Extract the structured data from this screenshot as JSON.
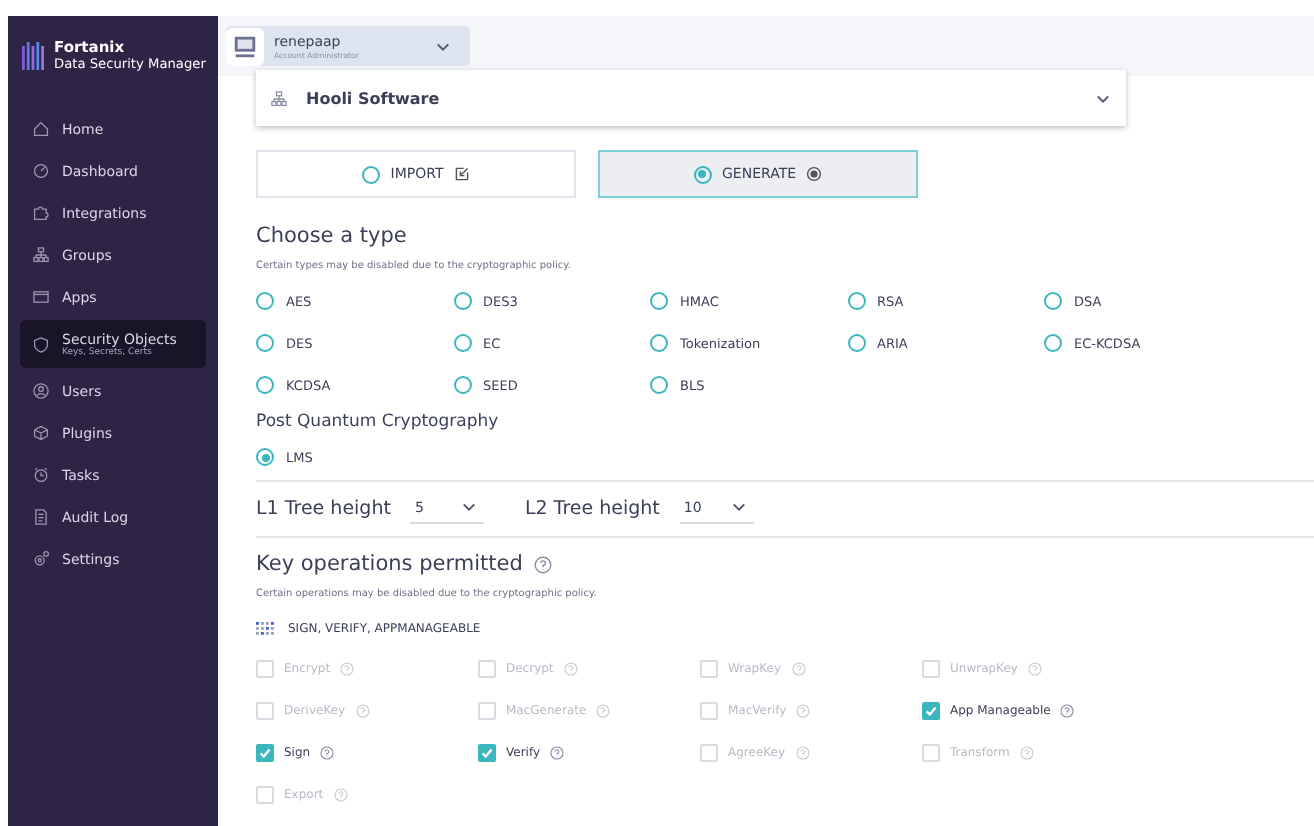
{
  "sidebar": {
    "logo": {
      "brand": "Fortanix",
      "product": "Data Security Manager"
    },
    "items": [
      {
        "label": "Home",
        "kind": "home",
        "selected": false
      },
      {
        "label": "Dashboard",
        "kind": "gauge",
        "selected": false
      },
      {
        "label": "Integrations",
        "kind": "puzzle",
        "selected": false
      },
      {
        "label": "Groups",
        "kind": "tree",
        "selected": false
      },
      {
        "label": "Apps",
        "kind": "window",
        "selected": false
      },
      {
        "label": "Security Objects",
        "sublabel": "Keys, Secrets, Certs",
        "kind": "shield",
        "selected": true
      },
      {
        "label": "Users",
        "kind": "user",
        "selected": false
      },
      {
        "label": "Plugins",
        "kind": "box",
        "selected": false
      },
      {
        "label": "Tasks",
        "kind": "clock",
        "selected": false
      },
      {
        "label": "Audit Log",
        "kind": "log",
        "selected": false
      },
      {
        "label": "Settings",
        "kind": "gear",
        "selected": false
      }
    ]
  },
  "account": {
    "name": "renepaap",
    "role": "Account Administrator"
  },
  "group_select": {
    "value": "Hooli Software"
  },
  "mode_buttons": [
    {
      "label": "IMPORT",
      "selected": false
    },
    {
      "label": "GENERATE",
      "selected": true
    }
  ],
  "type_section": {
    "title": "Choose a type",
    "note": "Certain types may be disabled due to the cryptographic policy.",
    "types": [
      {
        "label": "AES",
        "selected": false
      },
      {
        "label": "DES3",
        "selected": false
      },
      {
        "label": "HMAC",
        "selected": false
      },
      {
        "label": "RSA",
        "selected": false
      },
      {
        "label": "DSA",
        "selected": false
      },
      {
        "label": "DES",
        "selected": false
      },
      {
        "label": "EC",
        "selected": false
      },
      {
        "label": "Tokenization",
        "selected": false
      },
      {
        "label": "ARIA",
        "selected": false
      },
      {
        "label": "EC-KCDSA",
        "selected": false
      },
      {
        "label": "KCDSA",
        "selected": false
      },
      {
        "label": "SEED",
        "selected": false
      },
      {
        "label": "BLS",
        "selected": false
      }
    ],
    "pqc_title": "Post Quantum Cryptography",
    "pqc_types": [
      {
        "label": "LMS",
        "selected": true
      }
    ]
  },
  "tree_heights": [
    {
      "label": "L1 Tree height",
      "value": "5"
    },
    {
      "label": "L2 Tree height",
      "value": "10"
    }
  ],
  "operations": {
    "title": "Key operations permitted",
    "note": "Certain operations may be disabled due to the cryptographic policy.",
    "summary": "SIGN, VERIFY, APPMANAGEABLE",
    "items": [
      {
        "label": "Encrypt",
        "checked": false,
        "disabled": true
      },
      {
        "label": "Decrypt",
        "checked": false,
        "disabled": true
      },
      {
        "label": "WrapKey",
        "checked": false,
        "disabled": true
      },
      {
        "label": "UnwrapKey",
        "checked": false,
        "disabled": true
      },
      {
        "label": "DeriveKey",
        "checked": false,
        "disabled": true
      },
      {
        "label": "MacGenerate",
        "checked": false,
        "disabled": true
      },
      {
        "label": "MacVerify",
        "checked": false,
        "disabled": true
      },
      {
        "label": "App Manageable",
        "checked": true,
        "disabled": false
      },
      {
        "label": "Sign",
        "checked": true,
        "disabled": false
      },
      {
        "label": "Verify",
        "checked": true,
        "disabled": false
      },
      {
        "label": "AgreeKey",
        "checked": false,
        "disabled": true
      },
      {
        "label": "Transform",
        "checked": false,
        "disabled": true
      },
      {
        "label": "Export",
        "checked": false,
        "disabled": true
      }
    ]
  }
}
